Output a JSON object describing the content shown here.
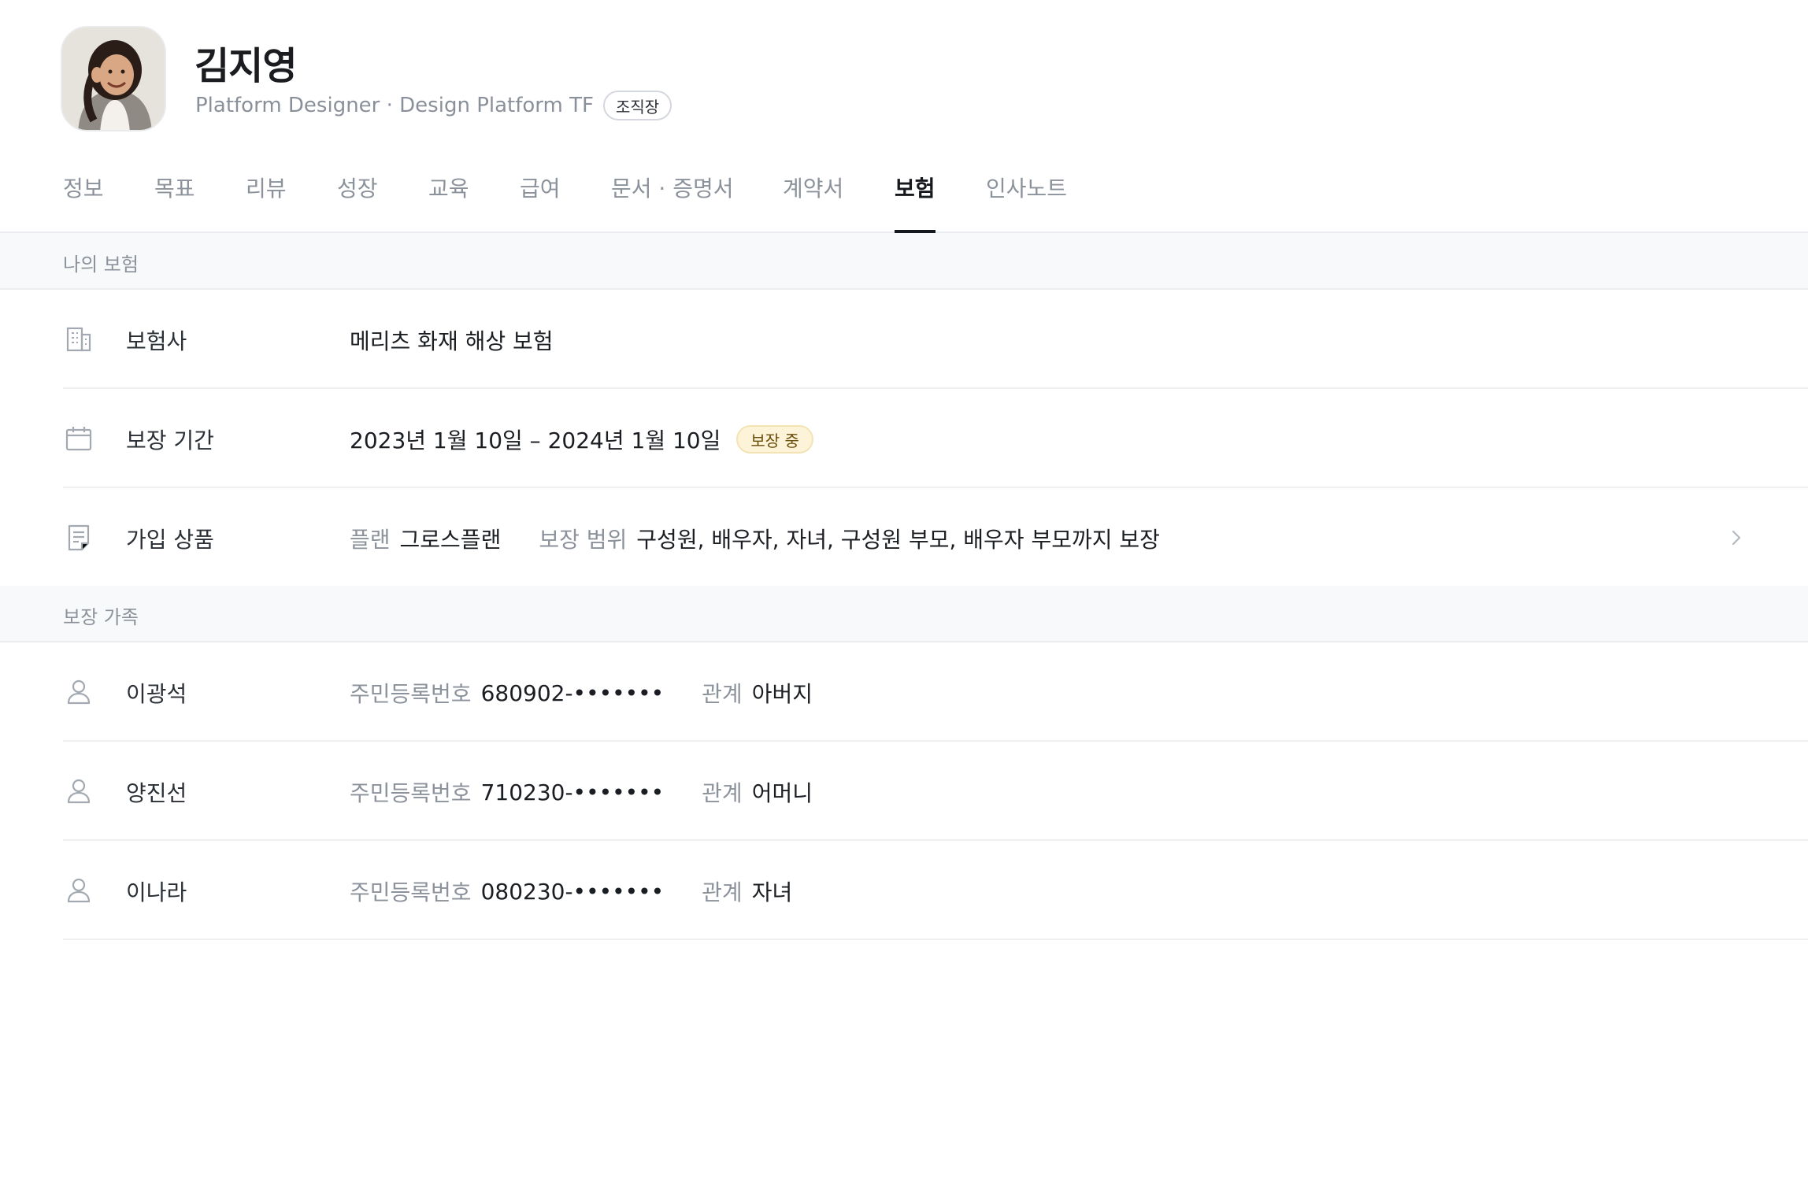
{
  "profile": {
    "name": "김지영",
    "role": "Platform Designer · Design Platform TF",
    "badge": "조직장"
  },
  "tabs": [
    {
      "label": "정보"
    },
    {
      "label": "목표"
    },
    {
      "label": "리뷰"
    },
    {
      "label": "성장"
    },
    {
      "label": "교육"
    },
    {
      "label": "급여"
    },
    {
      "label": "문서 · 증명서"
    },
    {
      "label": "계약서"
    },
    {
      "label": "보험",
      "active": true
    },
    {
      "label": "인사노트"
    }
  ],
  "my_insurance": {
    "title": "나의 보험",
    "insurer": {
      "label": "보험사",
      "value": "메리츠 화재 해상 보험",
      "icon": "building-icon"
    },
    "period": {
      "label": "보장 기간",
      "value": "2023년 1월 10일 – 2024년 1월 10일",
      "status": "보장 중",
      "icon": "calendar-icon"
    },
    "product": {
      "label": "가입 상품",
      "plan_label": "플랜",
      "plan_value": "그로스플랜",
      "scope_label": "보장 범위",
      "scope_value": "구성원, 배우자, 자녀, 구성원 부모, 배우자 부모까지 보장",
      "icon": "document-icon"
    }
  },
  "family": {
    "title": "보장 가족",
    "id_label": "주민등록번호",
    "relation_label": "관계",
    "members": [
      {
        "name": "이광석",
        "id": "680902-•••••••",
        "relation": "아버지"
      },
      {
        "name": "양진선",
        "id": "710230-•••••••",
        "relation": "어머니"
      },
      {
        "name": "이나라",
        "id": "080230-•••••••",
        "relation": "자녀"
      }
    ]
  },
  "colors": {
    "accent": "#15181c",
    "muted": "#8b929b",
    "status_bg": "#fdf3d8",
    "status_text": "#6b4e0a"
  }
}
